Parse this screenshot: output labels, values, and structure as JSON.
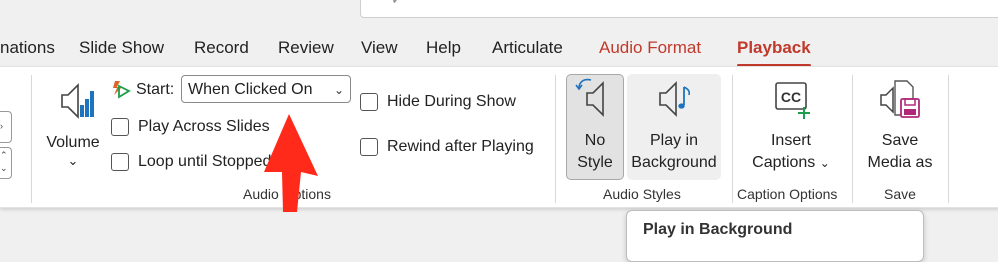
{
  "tabs": [
    {
      "label": "nations"
    },
    {
      "label": "Slide Show"
    },
    {
      "label": "Record"
    },
    {
      "label": "Review"
    },
    {
      "label": "View"
    },
    {
      "label": "Help"
    },
    {
      "label": "Articulate"
    },
    {
      "label": "Audio Format"
    },
    {
      "label": "Playback"
    }
  ],
  "audio_options": {
    "volume_label": "Volume",
    "start_label": "Start:",
    "start_value": "When Clicked On",
    "play_across_slides": "Play Across Slides",
    "loop_until_stopped": "Loop until Stopped",
    "hide_during_show": "Hide During Show",
    "rewind_after_playing": "Rewind after Playing",
    "group_label": "Audio Options"
  },
  "audio_styles": {
    "no_style_line1": "No",
    "no_style_line2": "Style",
    "play_bg_line1": "Play in",
    "play_bg_line2": "Background",
    "group_label": "Audio Styles"
  },
  "caption_options": {
    "insert_line1": "Insert",
    "insert_line2": "Captions",
    "group_label": "Caption Options"
  },
  "save": {
    "save_line1": "Save",
    "save_line2": "Media as",
    "group_label": "Save"
  },
  "tooltip": {
    "text": "Play in Background"
  },
  "colors": {
    "accent": "#c0392b",
    "annotation_arrow": "#ff2a1a",
    "icon_blue": "#1e73be",
    "icon_green": "#1e9e4a",
    "icon_magenta": "#b0287a"
  }
}
